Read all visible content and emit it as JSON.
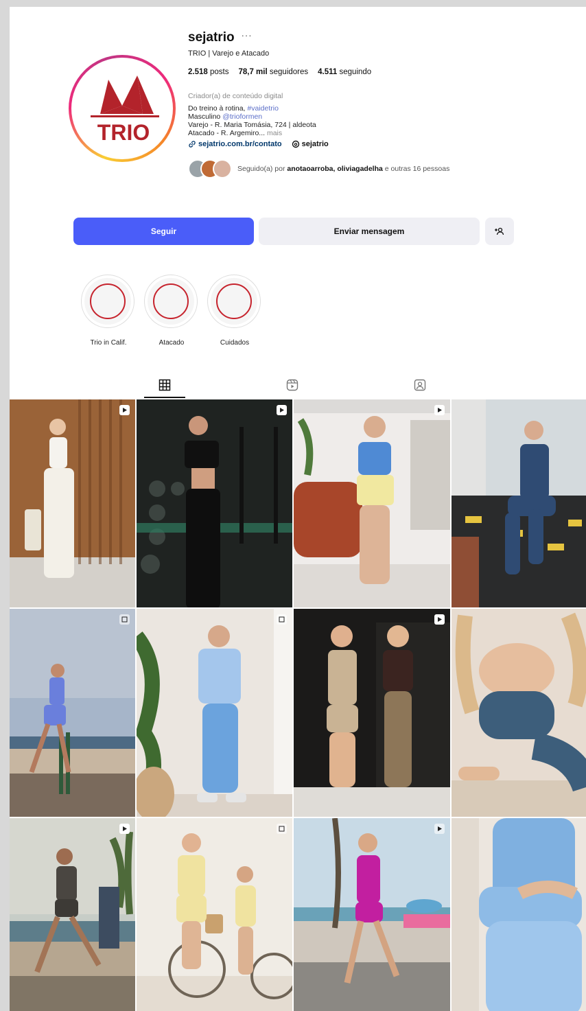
{
  "profile": {
    "username": "sejatrio",
    "more_label": "···",
    "full_name": "TRIO | Varejo e Atacado",
    "stats": {
      "posts": "2.518",
      "posts_label": "posts",
      "followers": "78,7 mil",
      "followers_label": "seguidores",
      "following": "4.511",
      "following_label": "seguindo"
    },
    "category": "Criador(a) de conteúdo digital",
    "bio": {
      "line1_text": "Do treino à rotina, ",
      "line1_tag": "#vaidetrio",
      "line2_text": "Masculino ",
      "line2_tag": "@trioformen",
      "line3": "Varejo - R. Maria Tomásia, 724 | aldeota",
      "line4_text": "Atacado - R. Argemiro...",
      "line4_more": " mais"
    },
    "link": "sejatrio.com.br/contato",
    "threads": "sejatrio",
    "followed_by": {
      "prefix": "Seguido(a) por ",
      "names": "anotaoarroba, oliviagadelha",
      "suffix": " e outras 16 pessoas"
    },
    "logo_text": "TRIO"
  },
  "actions": {
    "follow": "Seguir",
    "message": "Enviar mensagem"
  },
  "highlights": [
    {
      "label": "Trio in Calif."
    },
    {
      "label": "Atacado"
    },
    {
      "label": "Cuidados"
    }
  ],
  "colors": {
    "brand_red": "#b3232b",
    "follow_blue": "#4a5df9"
  }
}
